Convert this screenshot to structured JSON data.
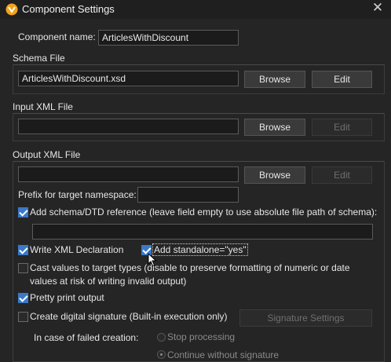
{
  "window": {
    "title": "Component Settings"
  },
  "component_name": {
    "label": "Component name:",
    "value": "ArticlesWithDiscount"
  },
  "schema_file": {
    "header": "Schema File",
    "value": "ArticlesWithDiscount.xsd",
    "browse": "Browse",
    "edit": "Edit"
  },
  "input_xml": {
    "header": "Input XML File",
    "value": "",
    "browse": "Browse",
    "edit": "Edit"
  },
  "output_xml": {
    "header": "Output XML File",
    "value": "",
    "browse": "Browse",
    "edit": "Edit",
    "prefix_label": "Prefix for target namespace:",
    "prefix_value": ""
  },
  "options": {
    "add_schema_ref": {
      "label": "Add schema/DTD reference (leave field empty to use absolute file path of schema):",
      "checked": true,
      "value": ""
    },
    "write_xml_decl": {
      "label": "Write XML Declaration",
      "checked": true
    },
    "standalone": {
      "label": "Add standalone=\"yes\"",
      "checked": true
    },
    "cast_values": {
      "label_line1": "Cast values to target types (disable to preserve formatting of numeric or date",
      "label_line2": "values at risk of writing invalid output)",
      "checked": false
    },
    "pretty_print": {
      "label": "Pretty print output",
      "checked": true
    },
    "digital_signature": {
      "label": "Create digital signature (Built-in execution only)",
      "checked": false
    },
    "signature_settings": "Signature Settings",
    "failed_label": "In case of failed creation:",
    "stop_processing": "Stop processing",
    "continue_without": "Continue without signature"
  }
}
